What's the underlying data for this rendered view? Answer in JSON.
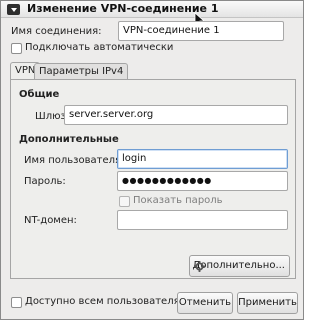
{
  "window": {
    "title": "Изменение VPN-соединение 1"
  },
  "connection": {
    "name_label": "Имя соединения:",
    "name_value": "VPN-соединение 1",
    "autoconnect_label": "Подключать автоматически"
  },
  "tabs": [
    {
      "label": "VPN",
      "active": true
    },
    {
      "label": "Параметры IPv4",
      "active": false
    }
  ],
  "general": {
    "heading": "Общие",
    "gateway_label": "Шлюз:",
    "gateway_value": "server.server.org"
  },
  "advanced": {
    "heading": "Дополнительные",
    "username_label": "Имя пользователя:",
    "username_value": "login",
    "password_label": "Пароль:",
    "password_value": "●●●●●●●●●●●●",
    "show_password_label": "Показать пароль",
    "nt_domain_label": "NT-домен:",
    "nt_domain_value": "",
    "advanced_button_label": "Дополнительно..."
  },
  "footer": {
    "all_users_label": "Доступно всем пользователям",
    "cancel_label": "Отменить",
    "apply_label": "Применить"
  },
  "colors": {
    "window_bg": "#edeceb",
    "focus_border": "#6f9dd3"
  }
}
